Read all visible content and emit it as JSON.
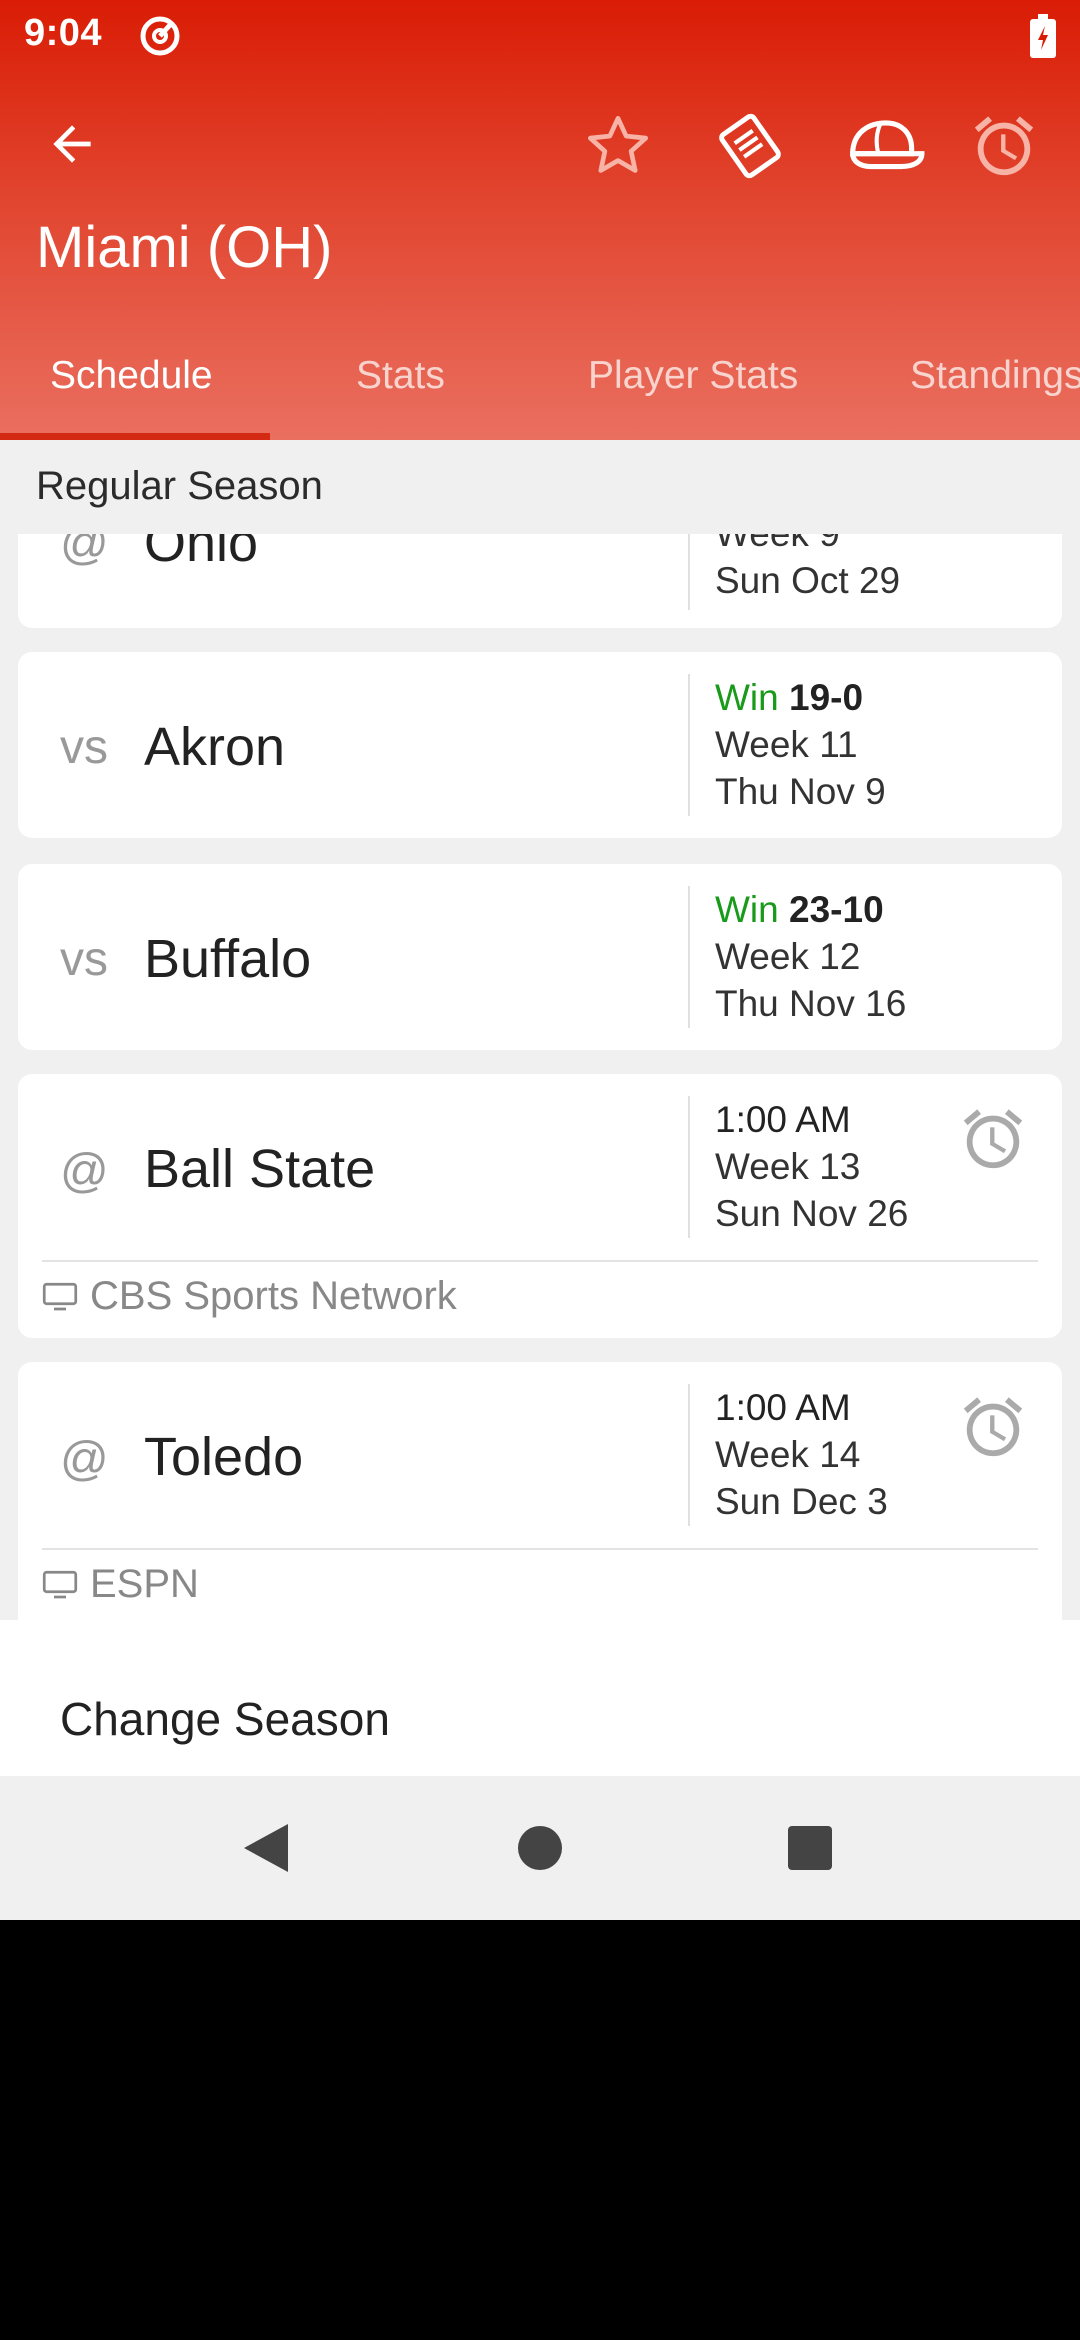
{
  "status_bar": {
    "time": "9:04"
  },
  "app_bar": {
    "title": "Miami (OH)",
    "actions": [
      "star-icon",
      "tickets-icon",
      "cap-icon",
      "alarm-icon"
    ]
  },
  "tabs": [
    {
      "label": "Schedule",
      "active": true
    },
    {
      "label": "Stats",
      "active": false
    },
    {
      "label": "Player Stats",
      "active": false
    },
    {
      "label": "Standings",
      "active": false
    }
  ],
  "section": {
    "label": "Regular Season"
  },
  "games": [
    {
      "ha": "@",
      "opponent": "Ohio",
      "week": "Week 9",
      "date": "Sun Oct 29"
    },
    {
      "ha": "vs",
      "opponent": "Akron",
      "result": "Win",
      "score": "19-0",
      "week": "Week 11",
      "date": "Thu Nov 9"
    },
    {
      "ha": "vs",
      "opponent": "Buffalo",
      "result": "Win",
      "score": "23-10",
      "week": "Week 12",
      "date": "Thu Nov 16"
    },
    {
      "ha": "@",
      "opponent": "Ball State",
      "time": "1:00 AM",
      "week": "Week 13",
      "date": "Sun Nov 26",
      "tv": "CBS Sports Network"
    },
    {
      "ha": "@",
      "opponent": "Toledo",
      "time": "1:00 AM",
      "week": "Week 14",
      "date": "Sun Dec 3",
      "tv": "ESPN"
    }
  ],
  "bottom_sheet": {
    "text": "Change Season"
  },
  "colors": {
    "header_top": "#da1c05",
    "header_bottom": "#ea6f5f",
    "win": "#1a9a1a"
  }
}
